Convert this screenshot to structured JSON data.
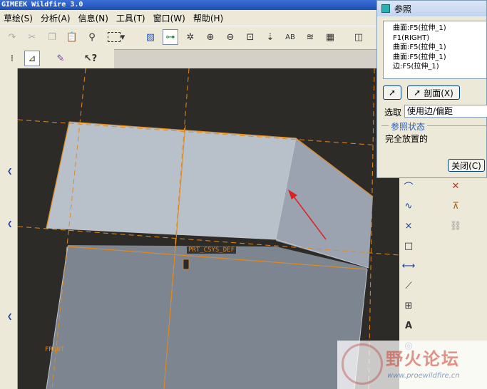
{
  "window": {
    "title": "GIMEEK Wildfire 3.0"
  },
  "menubar": {
    "items": [
      "草绘(S)",
      "分析(A)",
      "信息(N)",
      "工具(T)",
      "窗口(W)",
      "帮助(H)"
    ]
  },
  "model": {
    "csys_label": "PRT_CSYS_DEF",
    "datum_label": "FRONT"
  },
  "dialog": {
    "title": "参照",
    "references": [
      "曲面:F5(拉伸_1)",
      "F1(RIGHT)",
      "曲面:F5(拉伸_1)",
      "曲面:F5(拉伸_1)",
      "边:F5(拉伸_1)"
    ],
    "section_button": "剖面(X)",
    "select_label": "选取",
    "select_value": "使用边/偏距",
    "status_group": "参照状态",
    "status_text": "完全放置的",
    "close_button": "关闭(C)"
  },
  "watermark": {
    "text": "野火论坛",
    "url": "www.proewildfire.cn"
  },
  "colors": {
    "accent": "#e08a1e",
    "viewport_bg": "#2d2b27",
    "arrow": "#e02020"
  }
}
